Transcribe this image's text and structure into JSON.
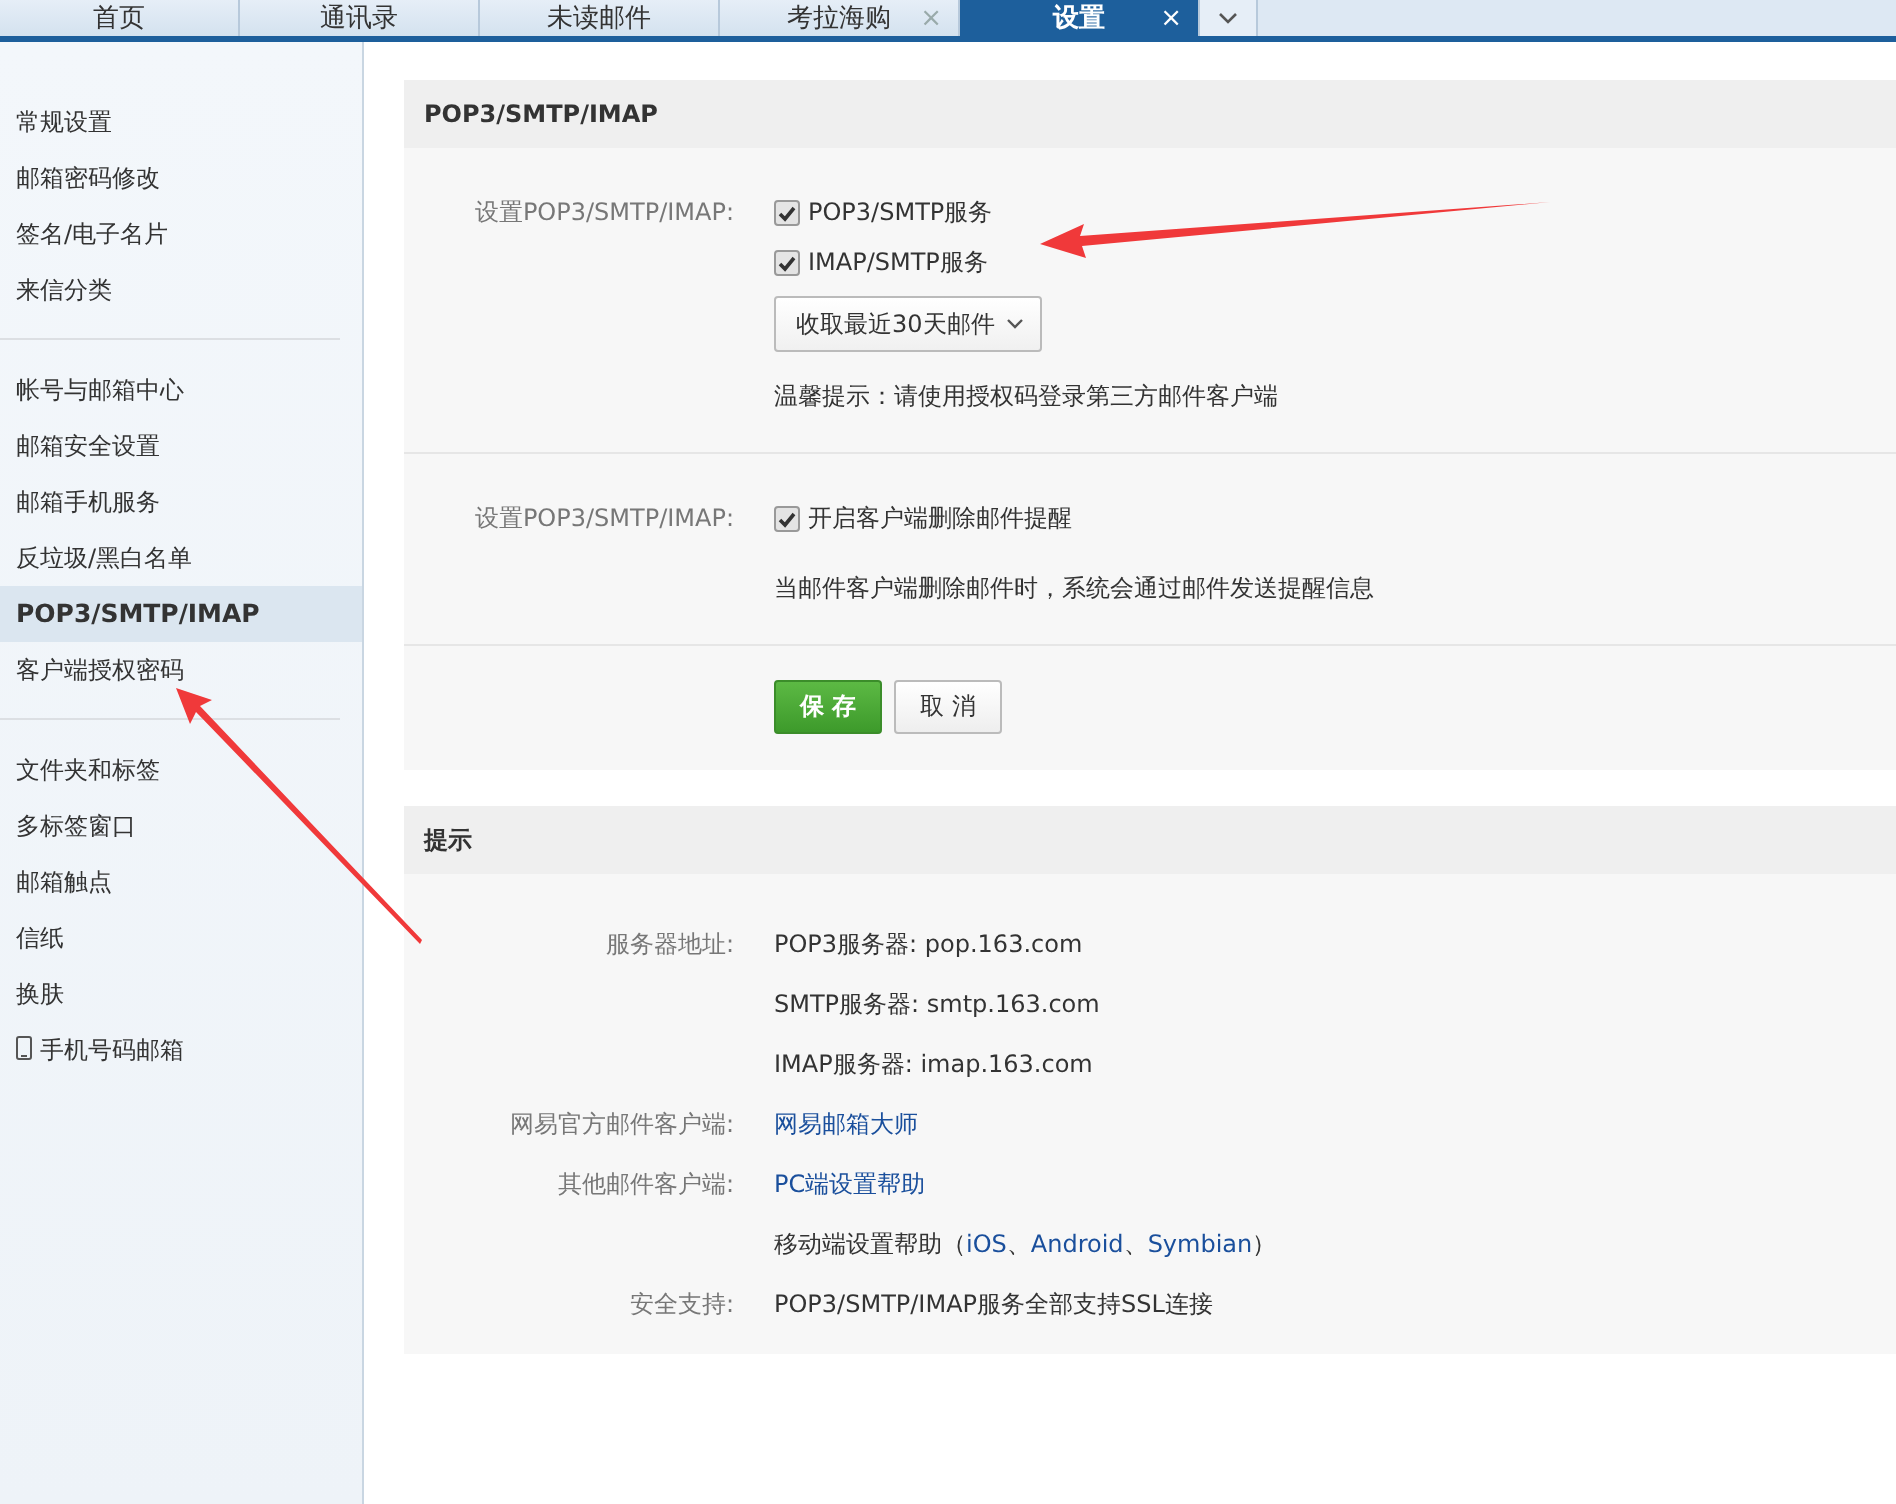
{
  "tabs": [
    {
      "label": "首页",
      "selected": false,
      "closable": false
    },
    {
      "label": "通讯录",
      "selected": false,
      "closable": false
    },
    {
      "label": "未读邮件",
      "selected": false,
      "closable": false
    },
    {
      "label": "考拉海购",
      "selected": false,
      "closable": true
    },
    {
      "label": "设置",
      "selected": true,
      "closable": true
    }
  ],
  "tab_close": "×",
  "sidebar": {
    "groups": [
      {
        "items": [
          {
            "label": "常规设置",
            "selected": false
          },
          {
            "label": "邮箱密码修改",
            "selected": false
          },
          {
            "label": "签名/电子名片",
            "selected": false
          },
          {
            "label": "来信分类",
            "selected": false
          }
        ]
      },
      {
        "items": [
          {
            "label": "帐号与邮箱中心",
            "selected": false
          },
          {
            "label": "邮箱安全设置",
            "selected": false
          },
          {
            "label": "邮箱手机服务",
            "selected": false
          },
          {
            "label": "反垃圾/黑白名单",
            "selected": false
          },
          {
            "label": "POP3/SMTP/IMAP",
            "selected": true
          },
          {
            "label": "客户端授权密码",
            "selected": false
          }
        ]
      },
      {
        "items": [
          {
            "label": "文件夹和标签",
            "selected": false
          },
          {
            "label": "多标签窗口",
            "selected": false
          },
          {
            "label": "邮箱触点",
            "selected": false
          },
          {
            "label": "信纸",
            "selected": false
          },
          {
            "label": "换肤",
            "selected": false
          },
          {
            "label": "手机号码邮箱",
            "selected": false,
            "kind": "phone"
          }
        ]
      }
    ]
  },
  "settings_panel": {
    "title": "POP3/SMTP/IMAP",
    "sections": [
      {
        "label": "设置POP3/SMTP/IMAP:",
        "checkboxes": [
          {
            "label": "POP3/SMTP服务",
            "checked": true
          },
          {
            "label": "IMAP/SMTP服务",
            "checked": true
          }
        ],
        "dropdown": "收取最近30天邮件",
        "note": "温馨提示：请使用授权码登录第三方邮件客户端"
      },
      {
        "label": "设置POP3/SMTP/IMAP:",
        "checkboxes": [
          {
            "label": "开启客户端删除邮件提醒",
            "checked": true
          }
        ],
        "note": "当邮件客户端删除邮件时，系统会通过邮件发送提醒信息"
      }
    ],
    "buttons": [
      {
        "label": "保 存",
        "kind": "primary"
      },
      {
        "label": "取 消",
        "kind": "secondary"
      }
    ]
  },
  "tips_panel": {
    "title": "提示",
    "rows": [
      {
        "label": "服务器地址:",
        "parts": [
          {
            "text": "POP3服务器: pop.163.com",
            "kind": "text"
          }
        ]
      },
      {
        "parts": [
          {
            "text": "SMTP服务器: smtp.163.com",
            "kind": "text"
          }
        ]
      },
      {
        "parts": [
          {
            "text": "IMAP服务器: imap.163.com",
            "kind": "text"
          }
        ]
      },
      {
        "label": "网易官方邮件客户端:",
        "parts": [
          {
            "text": "网易邮箱大师",
            "kind": "link"
          }
        ]
      },
      {
        "label": "其他邮件客户端:",
        "parts": [
          {
            "text": "PC端设置帮助",
            "kind": "link"
          }
        ]
      },
      {
        "parts": [
          {
            "text": "移动端设置帮助（",
            "kind": "text"
          },
          {
            "text": "iOS",
            "kind": "link"
          },
          {
            "text": "、",
            "kind": "text"
          },
          {
            "text": "Android",
            "kind": "link"
          },
          {
            "text": "、",
            "kind": "text"
          },
          {
            "text": "Symbian",
            "kind": "link"
          },
          {
            "text": "）",
            "kind": "text"
          }
        ]
      },
      {
        "label": "安全支持:",
        "parts": [
          {
            "text": "POP3/SMTP/IMAP服务全部支持SSL连接",
            "kind": "text"
          }
        ]
      }
    ]
  }
}
